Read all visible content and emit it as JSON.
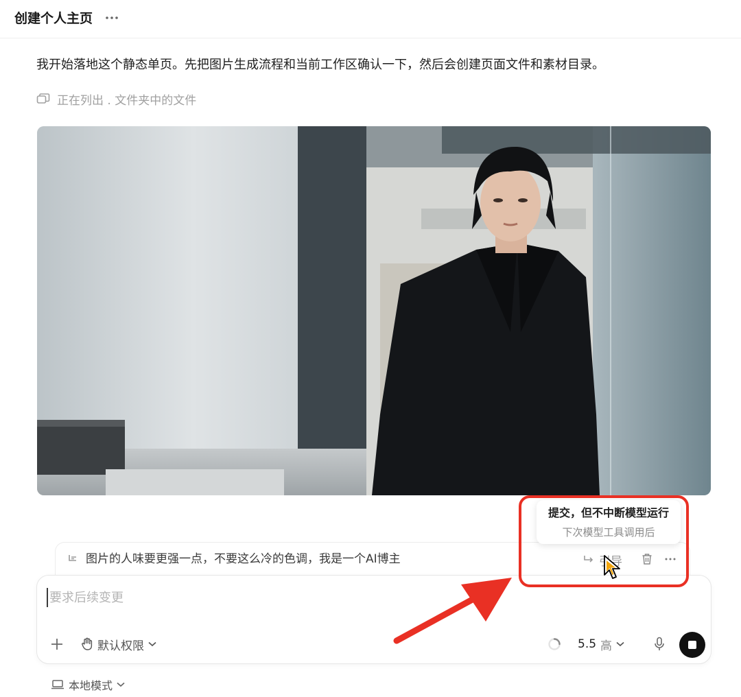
{
  "header": {
    "title": "创建个人主页",
    "menu_icon": "more-horizontal-icon"
  },
  "conversation": {
    "assistant_message": "我开始落地这个静态单页。先把图片生成流程和当前工作区确认一下，然后会创建页面文件和素材目录。",
    "status": {
      "icon": "folders-icon",
      "text": "正在列出 . 文件夹中的文件"
    },
    "image": {
      "description_icon": "portrait-photo"
    }
  },
  "queued_message": {
    "icon": "queue-reply-icon",
    "text": "图片的人味要更强一点，不要这么冷的色调，我是一个AI博主",
    "steer_label": "引导",
    "steer_icon": "redirect-arrow-icon",
    "delete_icon": "trash-icon",
    "more_icon": "more-horizontal-icon"
  },
  "tooltip": {
    "title": "提交，但不中断模型运行",
    "subtitle": "下次模型工具调用后"
  },
  "composer": {
    "placeholder": "要求后续变更",
    "value": "",
    "add_icon": "plus-icon",
    "permission_label": "默认权限",
    "permission_icon": "hand-icon",
    "model_version": "5.5",
    "model_level": "高",
    "mic_icon": "microphone-icon",
    "stop_icon": "stop-icon"
  },
  "footer": {
    "mode_label": "本地模式",
    "mode_icon": "laptop-icon"
  },
  "colors": {
    "annotation": "#e93024",
    "text_primary": "#1f1f1f",
    "text_muted": "#a0a0a0",
    "stop_button": "#111111"
  }
}
